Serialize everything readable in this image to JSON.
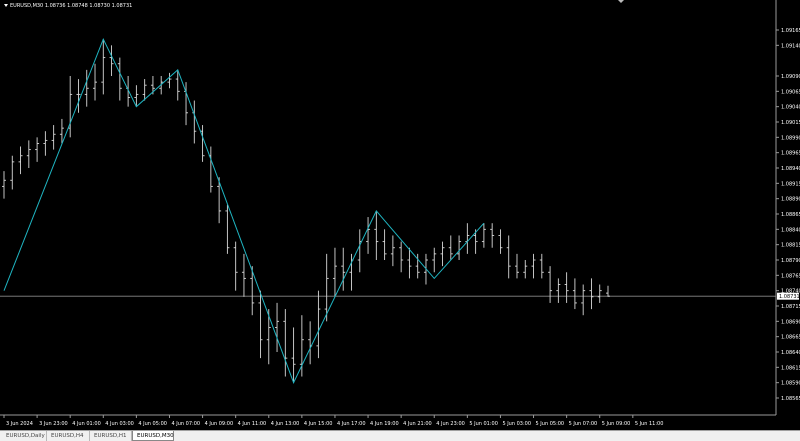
{
  "chart": {
    "title": "EURUSD,M30  1.08736 1.08748 1.08730 1.08731",
    "current_price_label": "1.08731",
    "colors": {
      "background": "#000000",
      "bars": "#d9d9d9",
      "zigzag": "#1fb5c2",
      "price_line": "#8a8a8a",
      "axis": "#9a9a9a",
      "text": "#ffffff"
    }
  },
  "tabs": [
    {
      "label": "EURUSD,Daily",
      "active": false
    },
    {
      "label": "EURUSD,H4",
      "active": false
    },
    {
      "label": "EURUSD,H1",
      "active": false
    },
    {
      "label": "EURUSD,M30",
      "active": true
    }
  ],
  "chart_data": {
    "type": "ohlc",
    "symbol": "EURUSD",
    "timeframe": "M30",
    "y_ticks": [
      "1.09165",
      "1.09140",
      "1.09090",
      "1.09065",
      "1.09040",
      "1.09015",
      "1.08990",
      "1.08965",
      "1.08940",
      "1.08915",
      "1.08890",
      "1.08865",
      "1.08840",
      "1.08815",
      "1.08790",
      "1.08765",
      "1.08740",
      "1.08715",
      "1.08690",
      "1.08665",
      "1.08640",
      "1.08615",
      "1.08590",
      "1.08565"
    ],
    "x_ticks": [
      "3 Jun 2024",
      "3 Jun 23:00",
      "4 Jun 01:00",
      "4 Jun 03:00",
      "4 Jun 05:00",
      "4 Jun 07:00",
      "4 Jun 09:00",
      "4 Jun 11:00",
      "4 Jun 13:00",
      "4 Jun 15:00",
      "4 Jun 17:00",
      "4 Jun 19:00",
      "4 Jun 21:00",
      "4 Jun 23:00",
      "5 Jun 01:00",
      "5 Jun 03:00",
      "5 Jun 05:00",
      "5 Jun 07:00",
      "5 Jun 09:00",
      "5 Jun 11:00"
    ],
    "ylim": [
      1.08565,
      1.09165
    ],
    "current_price": 1.08731,
    "bars": [
      {
        "o": 1.0891,
        "h": 1.08935,
        "l": 1.0889,
        "c": 1.0892
      },
      {
        "o": 1.0892,
        "h": 1.0896,
        "l": 1.08905,
        "c": 1.0895
      },
      {
        "o": 1.0895,
        "h": 1.08975,
        "l": 1.0893,
        "c": 1.0896
      },
      {
        "o": 1.0896,
        "h": 1.08985,
        "l": 1.0894,
        "c": 1.0897
      },
      {
        "o": 1.0897,
        "h": 1.0899,
        "l": 1.0895,
        "c": 1.0898
      },
      {
        "o": 1.0898,
        "h": 1.09,
        "l": 1.0896,
        "c": 1.08985
      },
      {
        "o": 1.08985,
        "h": 1.0901,
        "l": 1.0897,
        "c": 1.08995
      },
      {
        "o": 1.08995,
        "h": 1.0902,
        "l": 1.0898,
        "c": 1.09005
      },
      {
        "o": 1.09005,
        "h": 1.0909,
        "l": 1.0899,
        "c": 1.0906
      },
      {
        "o": 1.0906,
        "h": 1.09085,
        "l": 1.0903,
        "c": 1.0906
      },
      {
        "o": 1.0906,
        "h": 1.091,
        "l": 1.0904,
        "c": 1.0907
      },
      {
        "o": 1.0907,
        "h": 1.0911,
        "l": 1.0905,
        "c": 1.0908
      },
      {
        "o": 1.0908,
        "h": 1.0915,
        "l": 1.0906,
        "c": 1.0912
      },
      {
        "o": 1.0912,
        "h": 1.0914,
        "l": 1.0909,
        "c": 1.0911
      },
      {
        "o": 1.0911,
        "h": 1.0912,
        "l": 1.0905,
        "c": 1.0907
      },
      {
        "o": 1.0907,
        "h": 1.0909,
        "l": 1.0904,
        "c": 1.09055
      },
      {
        "o": 1.09055,
        "h": 1.09075,
        "l": 1.0904,
        "c": 1.0906
      },
      {
        "o": 1.0906,
        "h": 1.09085,
        "l": 1.0905,
        "c": 1.09075
      },
      {
        "o": 1.09075,
        "h": 1.0909,
        "l": 1.0906,
        "c": 1.0907
      },
      {
        "o": 1.0907,
        "h": 1.0909,
        "l": 1.0906,
        "c": 1.0908
      },
      {
        "o": 1.0908,
        "h": 1.09095,
        "l": 1.0907,
        "c": 1.09085
      },
      {
        "o": 1.09085,
        "h": 1.091,
        "l": 1.0905,
        "c": 1.09065
      },
      {
        "o": 1.09065,
        "h": 1.0908,
        "l": 1.0901,
        "c": 1.0903
      },
      {
        "o": 1.0903,
        "h": 1.0905,
        "l": 1.0898,
        "c": 1.09
      },
      {
        "o": 1.09,
        "h": 1.0901,
        "l": 1.0895,
        "c": 1.0896
      },
      {
        "o": 1.0896,
        "h": 1.08975,
        "l": 1.089,
        "c": 1.0891
      },
      {
        "o": 1.0891,
        "h": 1.08925,
        "l": 1.0885,
        "c": 1.0887
      },
      {
        "o": 1.0887,
        "h": 1.0888,
        "l": 1.088,
        "c": 1.0881
      },
      {
        "o": 1.0881,
        "h": 1.0882,
        "l": 1.0874,
        "c": 1.0877
      },
      {
        "o": 1.0877,
        "h": 1.088,
        "l": 1.0873,
        "c": 1.0876
      },
      {
        "o": 1.0876,
        "h": 1.0878,
        "l": 1.087,
        "c": 1.0872
      },
      {
        "o": 1.0872,
        "h": 1.0874,
        "l": 1.0863,
        "c": 1.0866
      },
      {
        "o": 1.0866,
        "h": 1.0871,
        "l": 1.0862,
        "c": 1.0868
      },
      {
        "o": 1.0868,
        "h": 1.0872,
        "l": 1.0864,
        "c": 1.0869
      },
      {
        "o": 1.0869,
        "h": 1.0871,
        "l": 1.086,
        "c": 1.0863
      },
      {
        "o": 1.0863,
        "h": 1.0868,
        "l": 1.0859,
        "c": 1.0862
      },
      {
        "o": 1.0862,
        "h": 1.087,
        "l": 1.086,
        "c": 1.0866
      },
      {
        "o": 1.0866,
        "h": 1.0869,
        "l": 1.0862,
        "c": 1.0865
      },
      {
        "o": 1.0865,
        "h": 1.0874,
        "l": 1.0863,
        "c": 1.0871
      },
      {
        "o": 1.0871,
        "h": 1.088,
        "l": 1.0869,
        "c": 1.0876
      },
      {
        "o": 1.0876,
        "h": 1.0881,
        "l": 1.0873,
        "c": 1.0878
      },
      {
        "o": 1.0878,
        "h": 1.0881,
        "l": 1.0874,
        "c": 1.0877
      },
      {
        "o": 1.0877,
        "h": 1.088,
        "l": 1.0874,
        "c": 1.0879
      },
      {
        "o": 1.0879,
        "h": 1.0884,
        "l": 1.0877,
        "c": 1.0882
      },
      {
        "o": 1.0882,
        "h": 1.0886,
        "l": 1.088,
        "c": 1.0884
      },
      {
        "o": 1.0884,
        "h": 1.0887,
        "l": 1.0879,
        "c": 1.0882
      },
      {
        "o": 1.0882,
        "h": 1.0884,
        "l": 1.0879,
        "c": 1.088
      },
      {
        "o": 1.088,
        "h": 1.0883,
        "l": 1.0878,
        "c": 1.0881
      },
      {
        "o": 1.0881,
        "h": 1.0882,
        "l": 1.0877,
        "c": 1.0879
      },
      {
        "o": 1.0879,
        "h": 1.0881,
        "l": 1.0876,
        "c": 1.0878
      },
      {
        "o": 1.0878,
        "h": 1.088,
        "l": 1.0876,
        "c": 1.0877
      },
      {
        "o": 1.0877,
        "h": 1.088,
        "l": 1.0875,
        "c": 1.0879
      },
      {
        "o": 1.0879,
        "h": 1.0881,
        "l": 1.0877,
        "c": 1.088
      },
      {
        "o": 1.088,
        "h": 1.0882,
        "l": 1.0878,
        "c": 1.0881
      },
      {
        "o": 1.0881,
        "h": 1.0883,
        "l": 1.0879,
        "c": 1.088
      },
      {
        "o": 1.088,
        "h": 1.0883,
        "l": 1.0879,
        "c": 1.0882
      },
      {
        "o": 1.0882,
        "h": 1.0885,
        "l": 1.088,
        "c": 1.0883
      },
      {
        "o": 1.0883,
        "h": 1.0884,
        "l": 1.088,
        "c": 1.0882
      },
      {
        "o": 1.0882,
        "h": 1.0885,
        "l": 1.0881,
        "c": 1.0884
      },
      {
        "o": 1.0884,
        "h": 1.0885,
        "l": 1.0881,
        "c": 1.0883
      },
      {
        "o": 1.0883,
        "h": 1.0884,
        "l": 1.088,
        "c": 1.0881
      },
      {
        "o": 1.0881,
        "h": 1.0883,
        "l": 1.0876,
        "c": 1.0878
      },
      {
        "o": 1.0878,
        "h": 1.088,
        "l": 1.0876,
        "c": 1.0877
      },
      {
        "o": 1.0877,
        "h": 1.0879,
        "l": 1.0876,
        "c": 1.0878
      },
      {
        "o": 1.0878,
        "h": 1.088,
        "l": 1.0876,
        "c": 1.0879
      },
      {
        "o": 1.0879,
        "h": 1.088,
        "l": 1.0876,
        "c": 1.0877
      },
      {
        "o": 1.0877,
        "h": 1.0878,
        "l": 1.0872,
        "c": 1.0874
      },
      {
        "o": 1.0874,
        "h": 1.0876,
        "l": 1.0872,
        "c": 1.0875
      },
      {
        "o": 1.0875,
        "h": 1.0877,
        "l": 1.0872,
        "c": 1.0874
      },
      {
        "o": 1.0874,
        "h": 1.0876,
        "l": 1.0871,
        "c": 1.0872
      },
      {
        "o": 1.0872,
        "h": 1.0875,
        "l": 1.087,
        "c": 1.0874
      },
      {
        "o": 1.0874,
        "h": 1.0876,
        "l": 1.0871,
        "c": 1.0873
      },
      {
        "o": 1.0873,
        "h": 1.0875,
        "l": 1.0872,
        "c": 1.0874
      },
      {
        "o": 1.08736,
        "h": 1.08748,
        "l": 1.0873,
        "c": 1.08731
      }
    ],
    "zigzag": [
      {
        "bar": 0,
        "price": 1.0874
      },
      {
        "bar": 12,
        "price": 1.0915
      },
      {
        "bar": 16,
        "price": 1.0904
      },
      {
        "bar": 21,
        "price": 1.091
      },
      {
        "bar": 35,
        "price": 1.0859
      },
      {
        "bar": 45,
        "price": 1.0887
      },
      {
        "bar": 52,
        "price": 1.0876
      },
      {
        "bar": 58,
        "price": 1.0885
      }
    ]
  }
}
